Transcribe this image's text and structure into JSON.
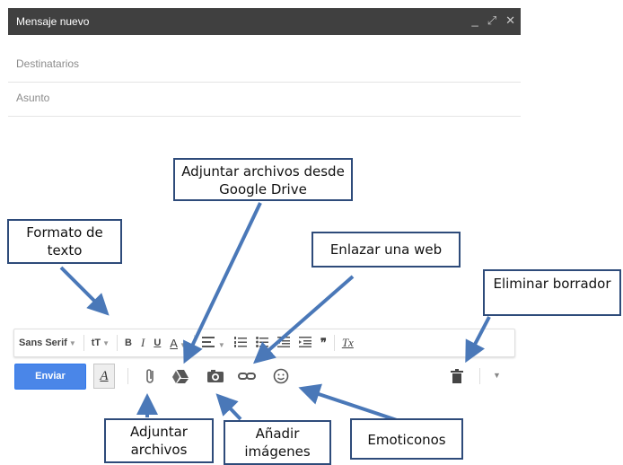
{
  "compose": {
    "title": "Mensaje nuevo",
    "window_icons": {
      "minimize": "_",
      "expand": "⤢",
      "close": "✕"
    },
    "recipients_placeholder": "Destinatarios",
    "subject_placeholder": "Asunto"
  },
  "format_toolbar": {
    "font": "Sans Serif",
    "size_icon": "tT",
    "bold": "B",
    "italic": "I",
    "underline": "U",
    "text_color": "A",
    "quote": "❞",
    "clear_format": "Tx"
  },
  "action_bar": {
    "send_label": "Enviar",
    "format_label": "A"
  },
  "callouts": {
    "format_text": "Formato de texto",
    "drive": "Adjuntar archivos desde Google Drive",
    "link": "Enlazar una web",
    "delete_draft": "Eliminar borrador",
    "attach": "Adjuntar archivos",
    "images": "Añadir imágenes",
    "emoticons": "Emoticonos"
  },
  "colors": {
    "arrow": "#4a78b8",
    "send": "#4a86e8",
    "titlebar": "#404040"
  }
}
